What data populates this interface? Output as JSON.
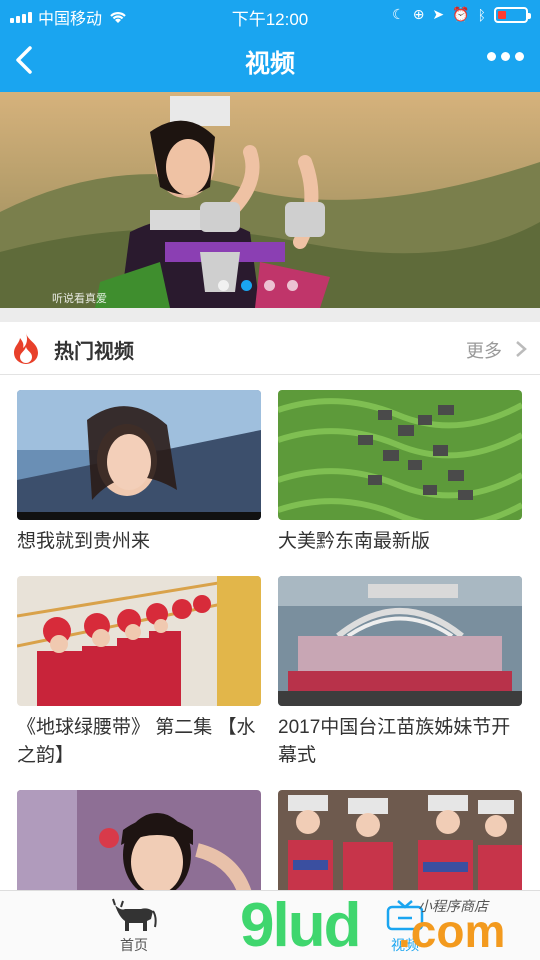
{
  "status_bar": {
    "carrier": "中国移动",
    "time": "下午12:00"
  },
  "nav": {
    "title": "视频"
  },
  "banner": {
    "caption": "听说看真爱",
    "page_count": 4,
    "active_page": 2
  },
  "section": {
    "title": "热门视频",
    "more_label": "更多"
  },
  "videos": [
    {
      "title": "想我就到贵州来"
    },
    {
      "title": "大美黔东南最新版"
    },
    {
      "title": "《地球绿腰带》 第二集 【水之韵】"
    },
    {
      "title": "2017中国台江苗族姊妹节开幕式"
    },
    {
      "title": ""
    },
    {
      "title": ""
    }
  ],
  "tabbar": {
    "tabs": [
      {
        "label": "首页",
        "icon": "bull-icon"
      },
      {
        "label": "视频",
        "icon": "tv-icon"
      }
    ]
  },
  "watermark": {
    "brand": "9lud",
    "suffix": ".com",
    "script": "小程序商店"
  },
  "colors": {
    "accent": "#1aa5f0",
    "battery_low": "#ff3b30"
  }
}
